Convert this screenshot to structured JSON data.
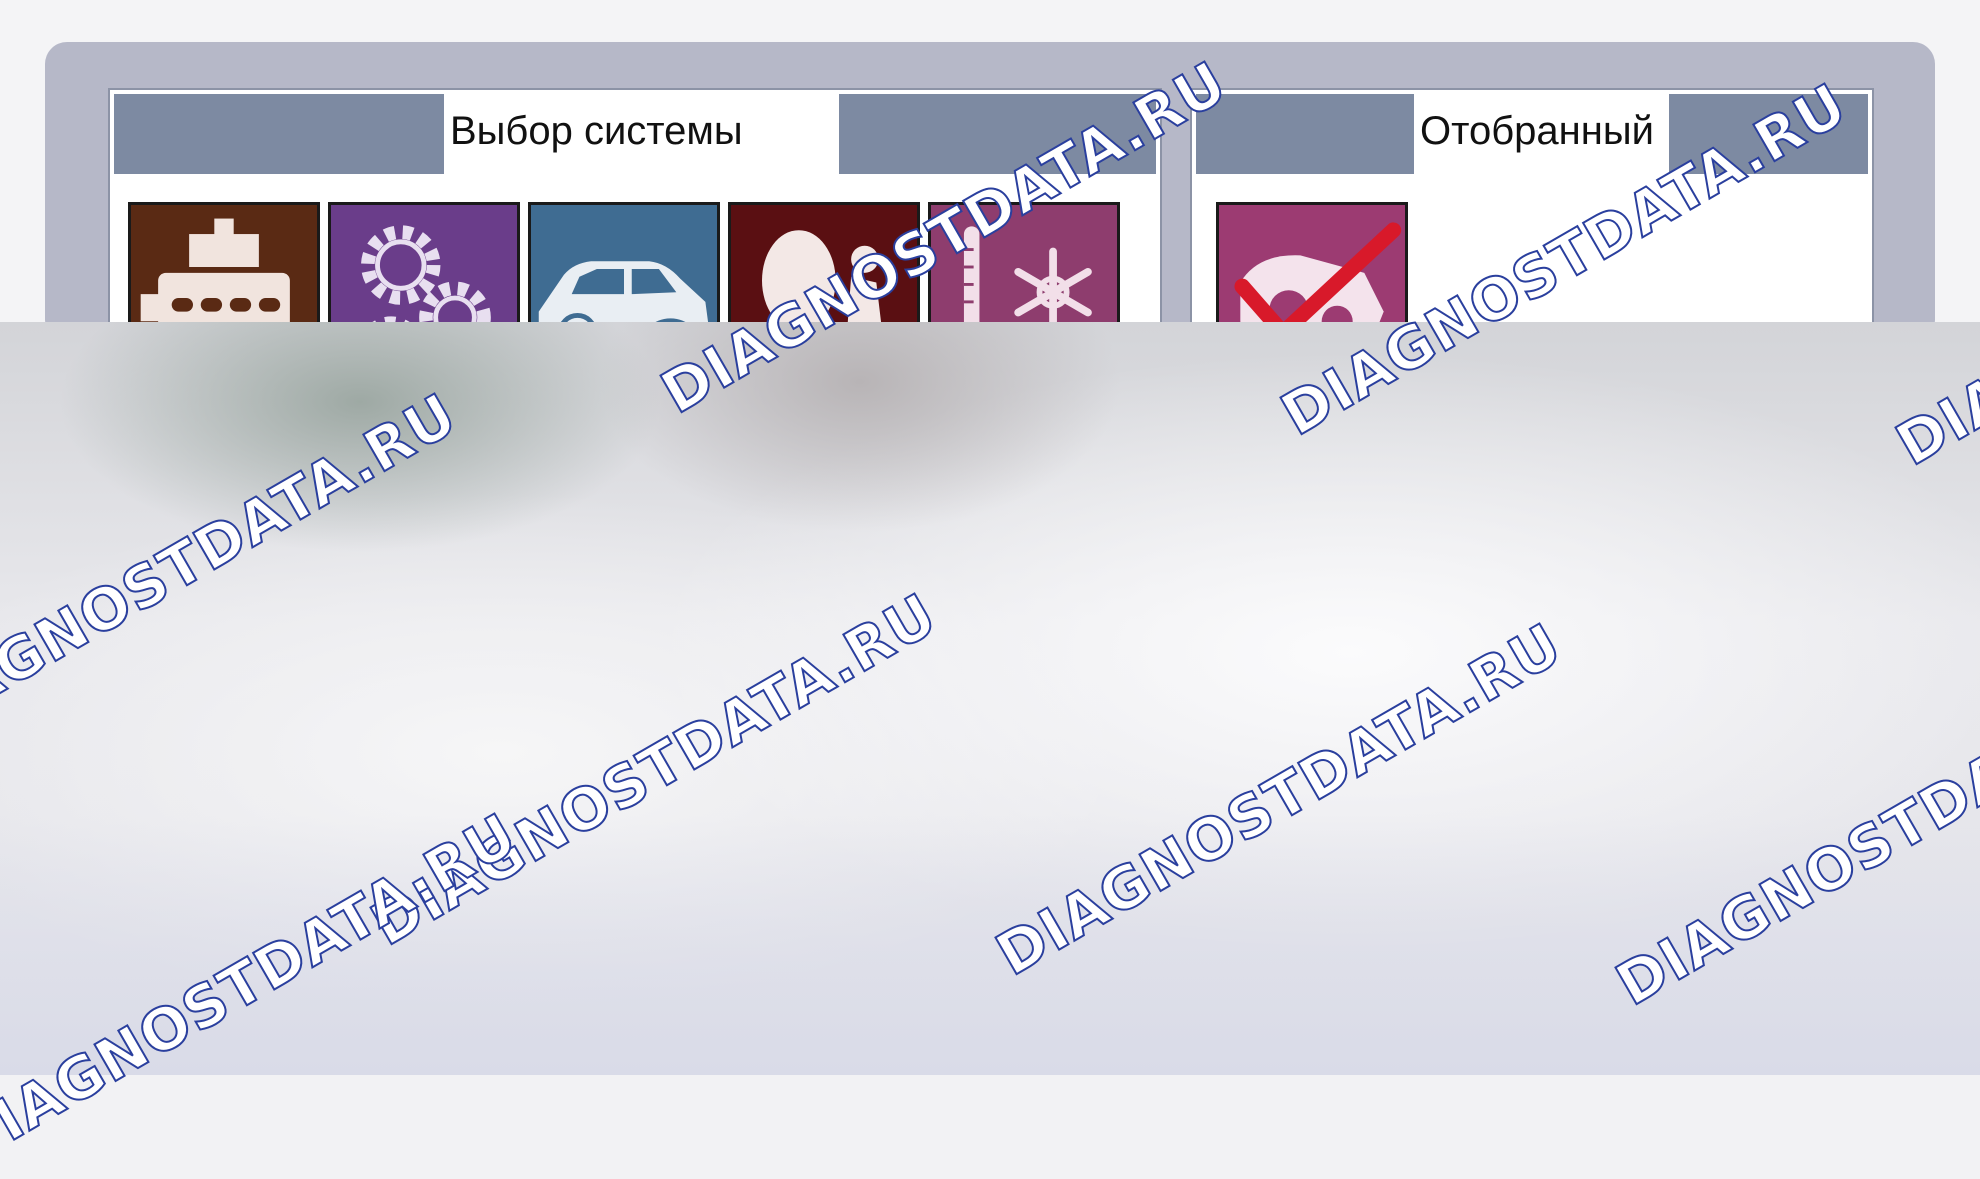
{
  "panels": {
    "system_select": {
      "title": "Выбор системы",
      "tiles": [
        {
          "icon": "engine-icon",
          "color": "#5a2a14"
        },
        {
          "icon": "gears-icon",
          "color": "#6a3d8a"
        },
        {
          "icon": "car-chassis-icon",
          "color": "#3f6c92"
        },
        {
          "icon": "airbag-seat-icon",
          "color": "#5a0f12"
        },
        {
          "icon": "climate-control-icon",
          "color": "#8e3d6e"
        }
      ]
    },
    "selected": {
      "title": "Отобранный",
      "tiles": [
        {
          "icon": "checked-component-icon",
          "color": "#9c3b72"
        }
      ]
    }
  },
  "watermark": {
    "text": "DIAGNOSTDATA.RU",
    "color": "#2a3f9e"
  }
}
